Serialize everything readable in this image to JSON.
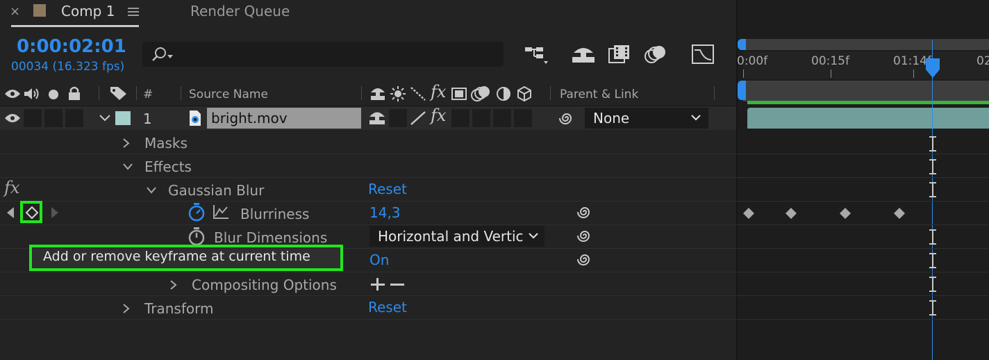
{
  "tabs": {
    "comp_tab": "Comp 1",
    "render_queue_tab": "Render Queue"
  },
  "time": {
    "timecode": "0:00:02:01",
    "frame_info": "00034 (16.323 fps)"
  },
  "search": {
    "placeholder": ""
  },
  "columns": {
    "hash": "#",
    "source_name": "Source Name",
    "parent_link": "Parent & Link"
  },
  "layer": {
    "number": "1",
    "name": "bright.mov",
    "label_color": "#a5cfcb",
    "parent_value": "None"
  },
  "properties": {
    "masks": "Masks",
    "effects": "Effects",
    "gaussian_blur": "Gaussian Blur",
    "gaussian_reset": "Reset",
    "blurriness": "Blurriness",
    "blurriness_value": "14,3",
    "blur_dimensions": "Blur Dimensions",
    "blur_dimensions_value": "Horizontal and Vertic",
    "repeat_edge_value": "On",
    "compositing_options": "Compositing Options",
    "transform": "Transform",
    "transform_reset": "Reset"
  },
  "tooltip": "Add or remove keyframe at current time",
  "ruler": {
    "tick_0": "0:00f",
    "tick_1": "00:15f",
    "tick_2": "01:14f",
    "tick_3": "02"
  },
  "colors": {
    "accent_blue": "#2d8ceb",
    "highlight_green": "#22e61e",
    "timeline_green": "#3bb33b",
    "layer_bar": "#6f9e9b"
  }
}
